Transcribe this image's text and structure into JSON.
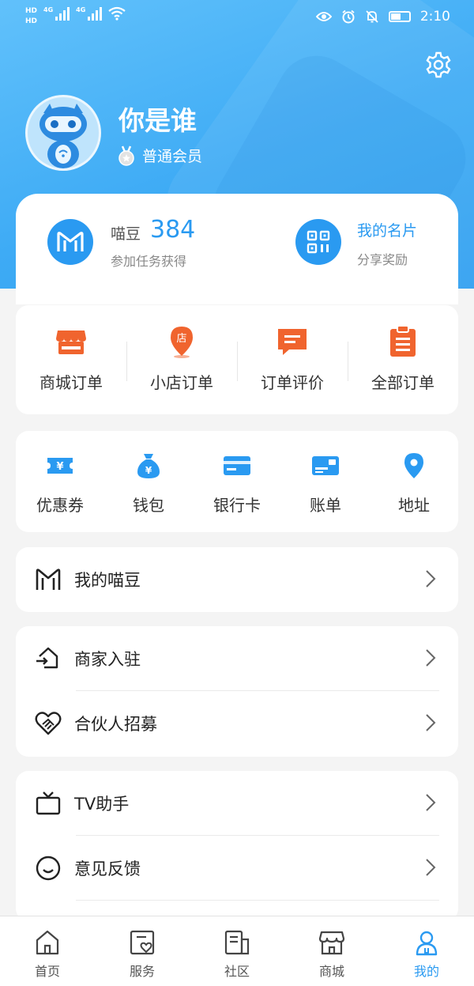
{
  "status_bar": {
    "hd_top": "HD",
    "hd_bottom": "HD",
    "net1": "4G",
    "net2": "4G",
    "time": "2:10"
  },
  "profile": {
    "name": "你是谁",
    "level": "普通会员"
  },
  "stats": {
    "miao_label": "喵豆",
    "miao_value": "384",
    "miao_sub": "参加任务获得",
    "card_label": "我的名片",
    "card_sub": "分享奖励"
  },
  "orders": [
    {
      "label": "商城订单",
      "icon": "shop-order-icon"
    },
    {
      "label": "小店订单",
      "icon": "store-location-icon"
    },
    {
      "label": "订单评价",
      "icon": "comment-icon"
    },
    {
      "label": "全部订单",
      "icon": "clipboard-icon"
    }
  ],
  "wallet": [
    {
      "label": "优惠券",
      "icon": "coupon-icon"
    },
    {
      "label": "钱包",
      "icon": "money-bag-icon"
    },
    {
      "label": "银行卡",
      "icon": "bank-card-icon"
    },
    {
      "label": "账单",
      "icon": "bill-icon"
    },
    {
      "label": "地址",
      "icon": "location-pin-icon"
    }
  ],
  "menu": {
    "my_miaodou": "我的喵豆",
    "merchant": "商家入驻",
    "partner": "合伙人招募",
    "tv": "TV助手",
    "feedback": "意见反馈"
  },
  "tabs": [
    {
      "label": "首页",
      "icon": "home-icon"
    },
    {
      "label": "服务",
      "icon": "service-icon"
    },
    {
      "label": "社区",
      "icon": "community-icon"
    },
    {
      "label": "商城",
      "icon": "mall-icon"
    },
    {
      "label": "我的",
      "icon": "profile-icon",
      "active": true
    }
  ],
  "colors": {
    "brand_blue": "#2a9af1",
    "order_orange": "#f0642e"
  }
}
